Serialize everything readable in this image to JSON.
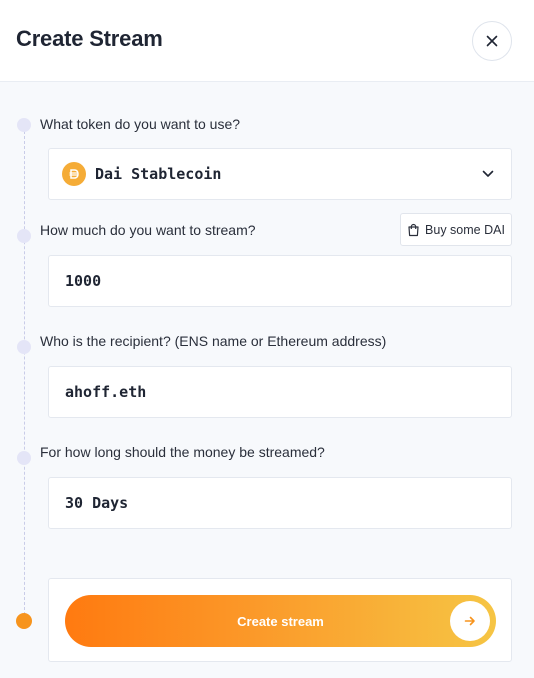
{
  "header": {
    "title": "Create Stream",
    "close_icon": "close-icon"
  },
  "steps": {
    "token": {
      "label": "What token do you want to use?",
      "selected": "Dai Stablecoin",
      "icon": "dai-token-icon"
    },
    "amount": {
      "label": "How much do you want to stream?",
      "value": "1000",
      "buy_label": "Buy some DAI",
      "buy_icon": "shopping-bag-icon"
    },
    "recipient": {
      "label": "Who is the recipient? (ENS name or Ethereum address)",
      "value": "ahoff.eth"
    },
    "duration": {
      "label": "For how long should the money be streamed?",
      "value": "30 Days"
    }
  },
  "submit": {
    "label": "Create stream",
    "icon": "arrow-right-icon"
  },
  "colors": {
    "accent": "#f7941d",
    "dai": "#f5ac37",
    "gradient_start": "#ff7a10",
    "gradient_end": "#f6c544"
  }
}
